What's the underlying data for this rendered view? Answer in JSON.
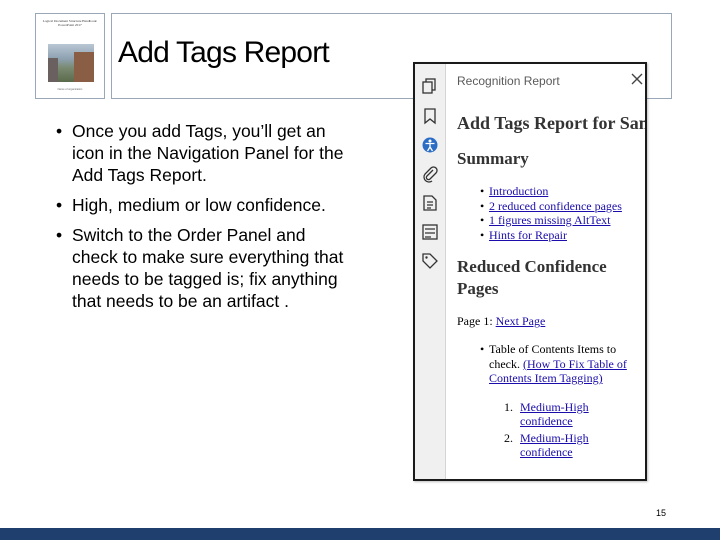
{
  "thumbnail": {
    "title": "Logical Document Structure Handbook: PowerPoint 2017",
    "footer": "Name of organization"
  },
  "slide": {
    "title": "Add Tags Report",
    "bullets": [
      "Once you add Tags, you’ll get an icon in the Navigation Panel for the Add Tags Report.",
      "High, medium or low confidence.",
      "Switch to the Order Panel and check to make sure everything that needs to be tagged is; fix anything that needs to be an artifact ."
    ],
    "number": "15"
  },
  "panel": {
    "header": "Recognition Report",
    "rail_icons": [
      "pages-icon",
      "bookmark-icon",
      "accessibility-report-icon",
      "attachment-icon",
      "content-icon",
      "order-icon",
      "tags-icon"
    ],
    "report": {
      "title": "Add Tags Report for SampleWordDocument",
      "summary_heading": "Summary",
      "summary_links": [
        "Introduction",
        "2 reduced confidence pages",
        "1 figures missing AltText",
        "Hints for Repair"
      ],
      "reduced_heading": "Reduced Confidence Pages",
      "page_label": "Page 1:",
      "next_page": "Next Page",
      "toc_text": "Table of Contents Items to check.",
      "toc_link": "(How To Fix Table of Contents Item Tagging)",
      "items": [
        {
          "num": "1.",
          "label": "Medium-High confidence"
        },
        {
          "num": "2.",
          "label": "Medium-High confidence"
        }
      ]
    }
  },
  "colors": {
    "bottom_bar": "#1f3f6e",
    "link": "#1a0dab",
    "active_icon": "#2b6cc4"
  }
}
